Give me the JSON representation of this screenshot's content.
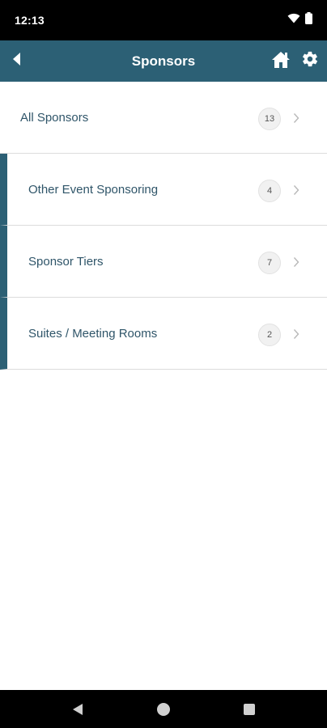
{
  "status_bar": {
    "time": "12:13",
    "icons": [
      "wifi-icon",
      "battery-icon"
    ]
  },
  "app_bar": {
    "title": "Sponsors",
    "icons": [
      "back-icon",
      "home-icon",
      "gear-icon"
    ],
    "color": "#2c6075"
  },
  "list": {
    "items": [
      {
        "label": "All Sponsors",
        "count": "13",
        "indented": false
      },
      {
        "label": "Other Event Sponsoring",
        "count": "4",
        "indented": true
      },
      {
        "label": "Sponsor Tiers",
        "count": "7",
        "indented": true
      },
      {
        "label": "Suites / Meeting Rooms",
        "count": "2",
        "indented": true
      }
    ]
  },
  "nav_bar": {
    "icons": [
      "nav-back-icon",
      "nav-home-icon",
      "nav-recents-icon"
    ]
  }
}
